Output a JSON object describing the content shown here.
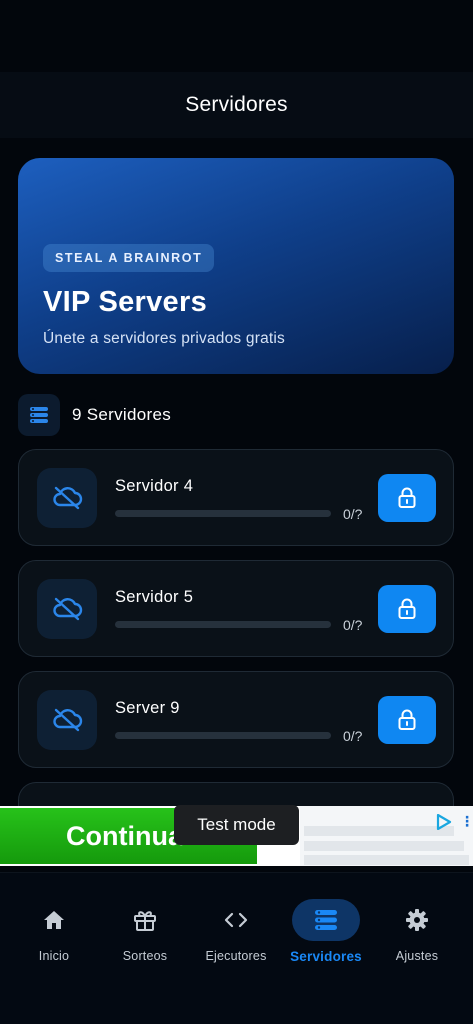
{
  "header": {
    "title": "Servidores"
  },
  "hero": {
    "tag": "STEAL A BRAINROT",
    "title": "VIP Servers",
    "subtitle": "Únete a servidores privados gratis"
  },
  "server_count": {
    "label": "9 Servidores"
  },
  "servers": [
    {
      "name": "Servidor 4",
      "count": "0/?",
      "status_icon": "cloud-off-icon",
      "action_icon": "lock-icon"
    },
    {
      "name": "Servidor 5",
      "count": "0/?",
      "status_icon": "cloud-off-icon",
      "action_icon": "lock-icon"
    },
    {
      "name": "Server 9",
      "count": "0/?",
      "status_icon": "cloud-off-icon",
      "action_icon": "lock-icon"
    }
  ],
  "ad": {
    "button_label": "Continua",
    "tooltip": "Test mode"
  },
  "nav": [
    {
      "label": "Inicio",
      "icon": "home-icon"
    },
    {
      "label": "Sorteos",
      "icon": "gift-icon"
    },
    {
      "label": "Ejecutores",
      "icon": "code-icon"
    },
    {
      "label": "Servidores",
      "icon": "servers-icon",
      "active": true
    },
    {
      "label": "Ajustes",
      "icon": "gear-icon"
    }
  ],
  "colors": {
    "background": "#02060c",
    "accent": "#0f87f2",
    "active_nav": "#1a88f5",
    "ad_green": "#27c21a"
  }
}
